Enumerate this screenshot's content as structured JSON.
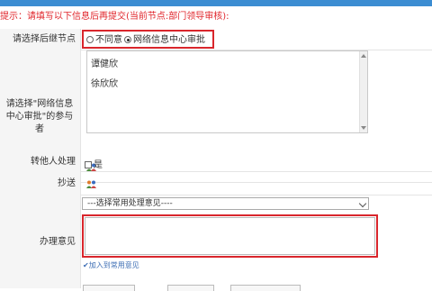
{
  "hint": "提示：请填写以下信息后再提交(当前节点:部门领导审核):",
  "rows": {
    "successor": {
      "label": "请选择后继节点",
      "options": [
        "不同意",
        "网络信息中心审批"
      ],
      "selected": "网络信息中心审批"
    },
    "participants": {
      "label": "请选择\"网络信息中心审批\"的参与者",
      "people": [
        "谭健欣",
        "徐欣欣"
      ],
      "add_icon": "people-icon"
    },
    "transfer": {
      "label": "转他人处理",
      "checkbox_label": "是"
    },
    "cc": {
      "label": "抄送",
      "add_icon": "people-icon"
    },
    "opinion": {
      "label": "办理意见",
      "select_value": "---选择常用处理意见----",
      "add_link": "加入到常用意见"
    }
  },
  "colors": {
    "highlight": "#d9262c",
    "hint": "#e0252b",
    "topbar": "#3c8dd2",
    "link": "#3f6fb5"
  }
}
